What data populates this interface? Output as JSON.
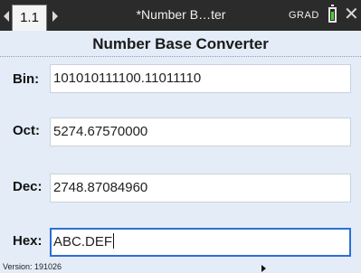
{
  "titlebar": {
    "tab_label": "1.1",
    "doc_title": "*Number B…ter",
    "mode": "GRAD",
    "battery_level": 0.7
  },
  "header": {
    "title": "Number Base Converter"
  },
  "rows": [
    {
      "label": "Bin:",
      "value": "101010111100.11011110"
    },
    {
      "label": "Oct:",
      "value": "5274.67570000"
    },
    {
      "label": "Dec:",
      "value": "2748.87084960"
    },
    {
      "label": "Hex:",
      "value": "ABC.DEF"
    }
  ],
  "footer": {
    "version": "Version: 191026"
  },
  "colors": {
    "titlebar": "#2b2b2b",
    "background": "#e3ecf7",
    "focus": "#2c6fd6",
    "battery": "#4fcf3a"
  }
}
